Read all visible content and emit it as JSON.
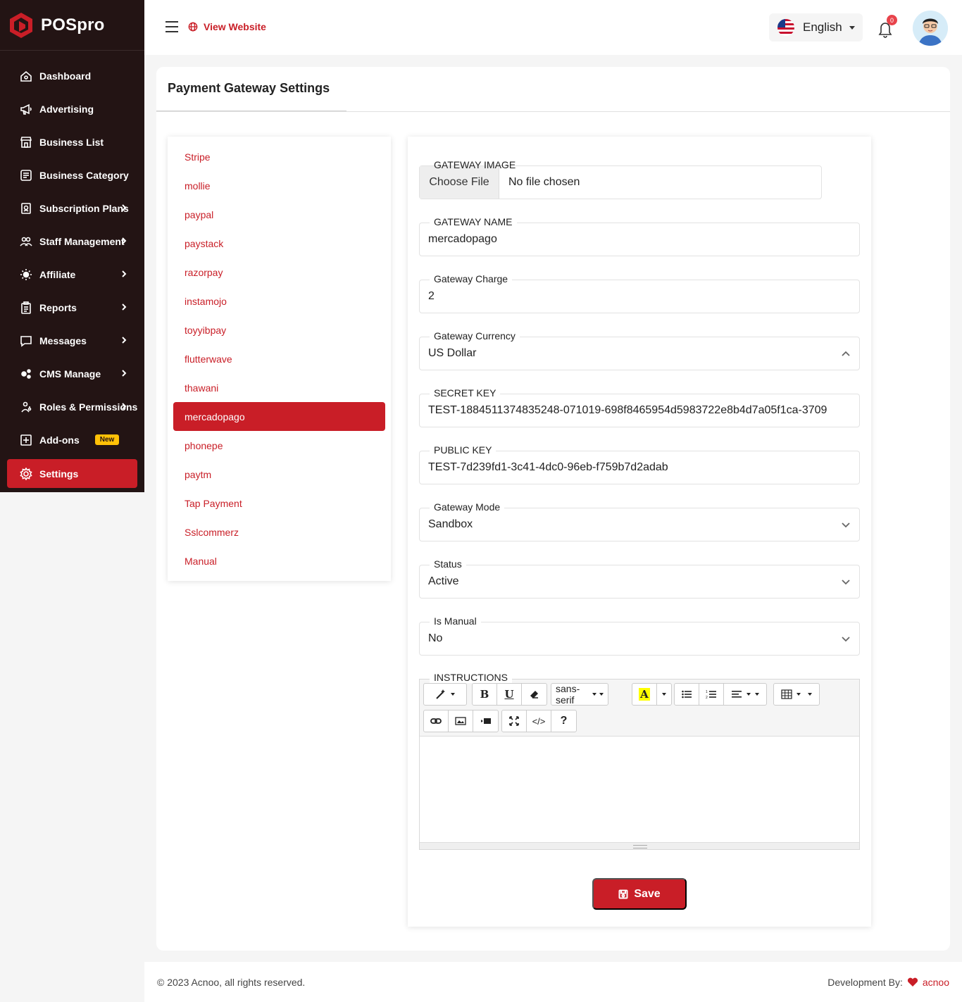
{
  "brand": {
    "name": "POSpro",
    "accent": "#c91e27",
    "sidebar_bg": "#231414"
  },
  "sidebar": {
    "items": [
      {
        "label": "Dashboard",
        "icon": "home-icon",
        "chevron": false
      },
      {
        "label": "Advertising",
        "icon": "megaphone-icon",
        "chevron": false
      },
      {
        "label": "Business List",
        "icon": "store-icon",
        "chevron": false
      },
      {
        "label": "Business Category",
        "icon": "list-icon",
        "chevron": false
      },
      {
        "label": "Subscription Plans",
        "icon": "badge-icon",
        "chevron": true
      },
      {
        "label": "Staff Management",
        "icon": "users-icon",
        "chevron": true
      },
      {
        "label": "Affiliate",
        "icon": "sun-icon",
        "chevron": true
      },
      {
        "label": "Reports",
        "icon": "clipboard-icon",
        "chevron": true
      },
      {
        "label": "Messages",
        "icon": "chat-icon",
        "chevron": true
      },
      {
        "label": "CMS Manage",
        "icon": "gears-icon",
        "chevron": true
      },
      {
        "label": "Roles & Permissions",
        "icon": "roles-icon",
        "chevron": true
      },
      {
        "label": "Add-ons",
        "icon": "plus-square-icon",
        "chevron": false,
        "badge": "New"
      },
      {
        "label": "Settings",
        "icon": "gear-icon",
        "chevron": false,
        "active": true
      }
    ]
  },
  "topbar": {
    "view_website": "View Website",
    "language": "English",
    "notification_count": "0"
  },
  "page": {
    "title": "Payment Gateway Settings"
  },
  "gateways": [
    "Stripe",
    "mollie",
    "paypal",
    "paystack",
    "razorpay",
    "instamojo",
    "toyyibpay",
    "flutterwave",
    "thawani",
    "mercadopago",
    "phonepe",
    "paytm",
    "Tap Payment",
    "Sslcommerz",
    "Manual"
  ],
  "active_gateway": "mercadopago",
  "form": {
    "gateway_image": {
      "label": "GATEWAY IMAGE",
      "button": "Choose File",
      "status": "No file chosen"
    },
    "gateway_name": {
      "label": "GATEWAY NAME",
      "value": "mercadopago"
    },
    "gateway_charge": {
      "label": "Gateway Charge",
      "value": "2"
    },
    "gateway_currency": {
      "label": "Gateway Currency",
      "value": "US Dollar"
    },
    "secret_key": {
      "label": "SECRET KEY",
      "value": "TEST-1884511374835248-071019-698f8465954d5983722e8b4d7a05f1ca-3709"
    },
    "public_key": {
      "label": "PUBLIC KEY",
      "value": "TEST-7d239fd1-3c41-4dc0-96eb-f759b7d2adab"
    },
    "gateway_mode": {
      "label": "Gateway Mode",
      "value": "Sandbox"
    },
    "status": {
      "label": "Status",
      "value": "Active"
    },
    "is_manual": {
      "label": "Is Manual",
      "value": "No"
    },
    "instructions": {
      "label": "INSTRUCTIONS",
      "font": "sans-serif"
    },
    "save": "Save"
  },
  "footer": {
    "copyright": "© 2023 Acnoo, all rights reserved.",
    "dev_by": "Development By:",
    "dev_name": "acnoo"
  }
}
